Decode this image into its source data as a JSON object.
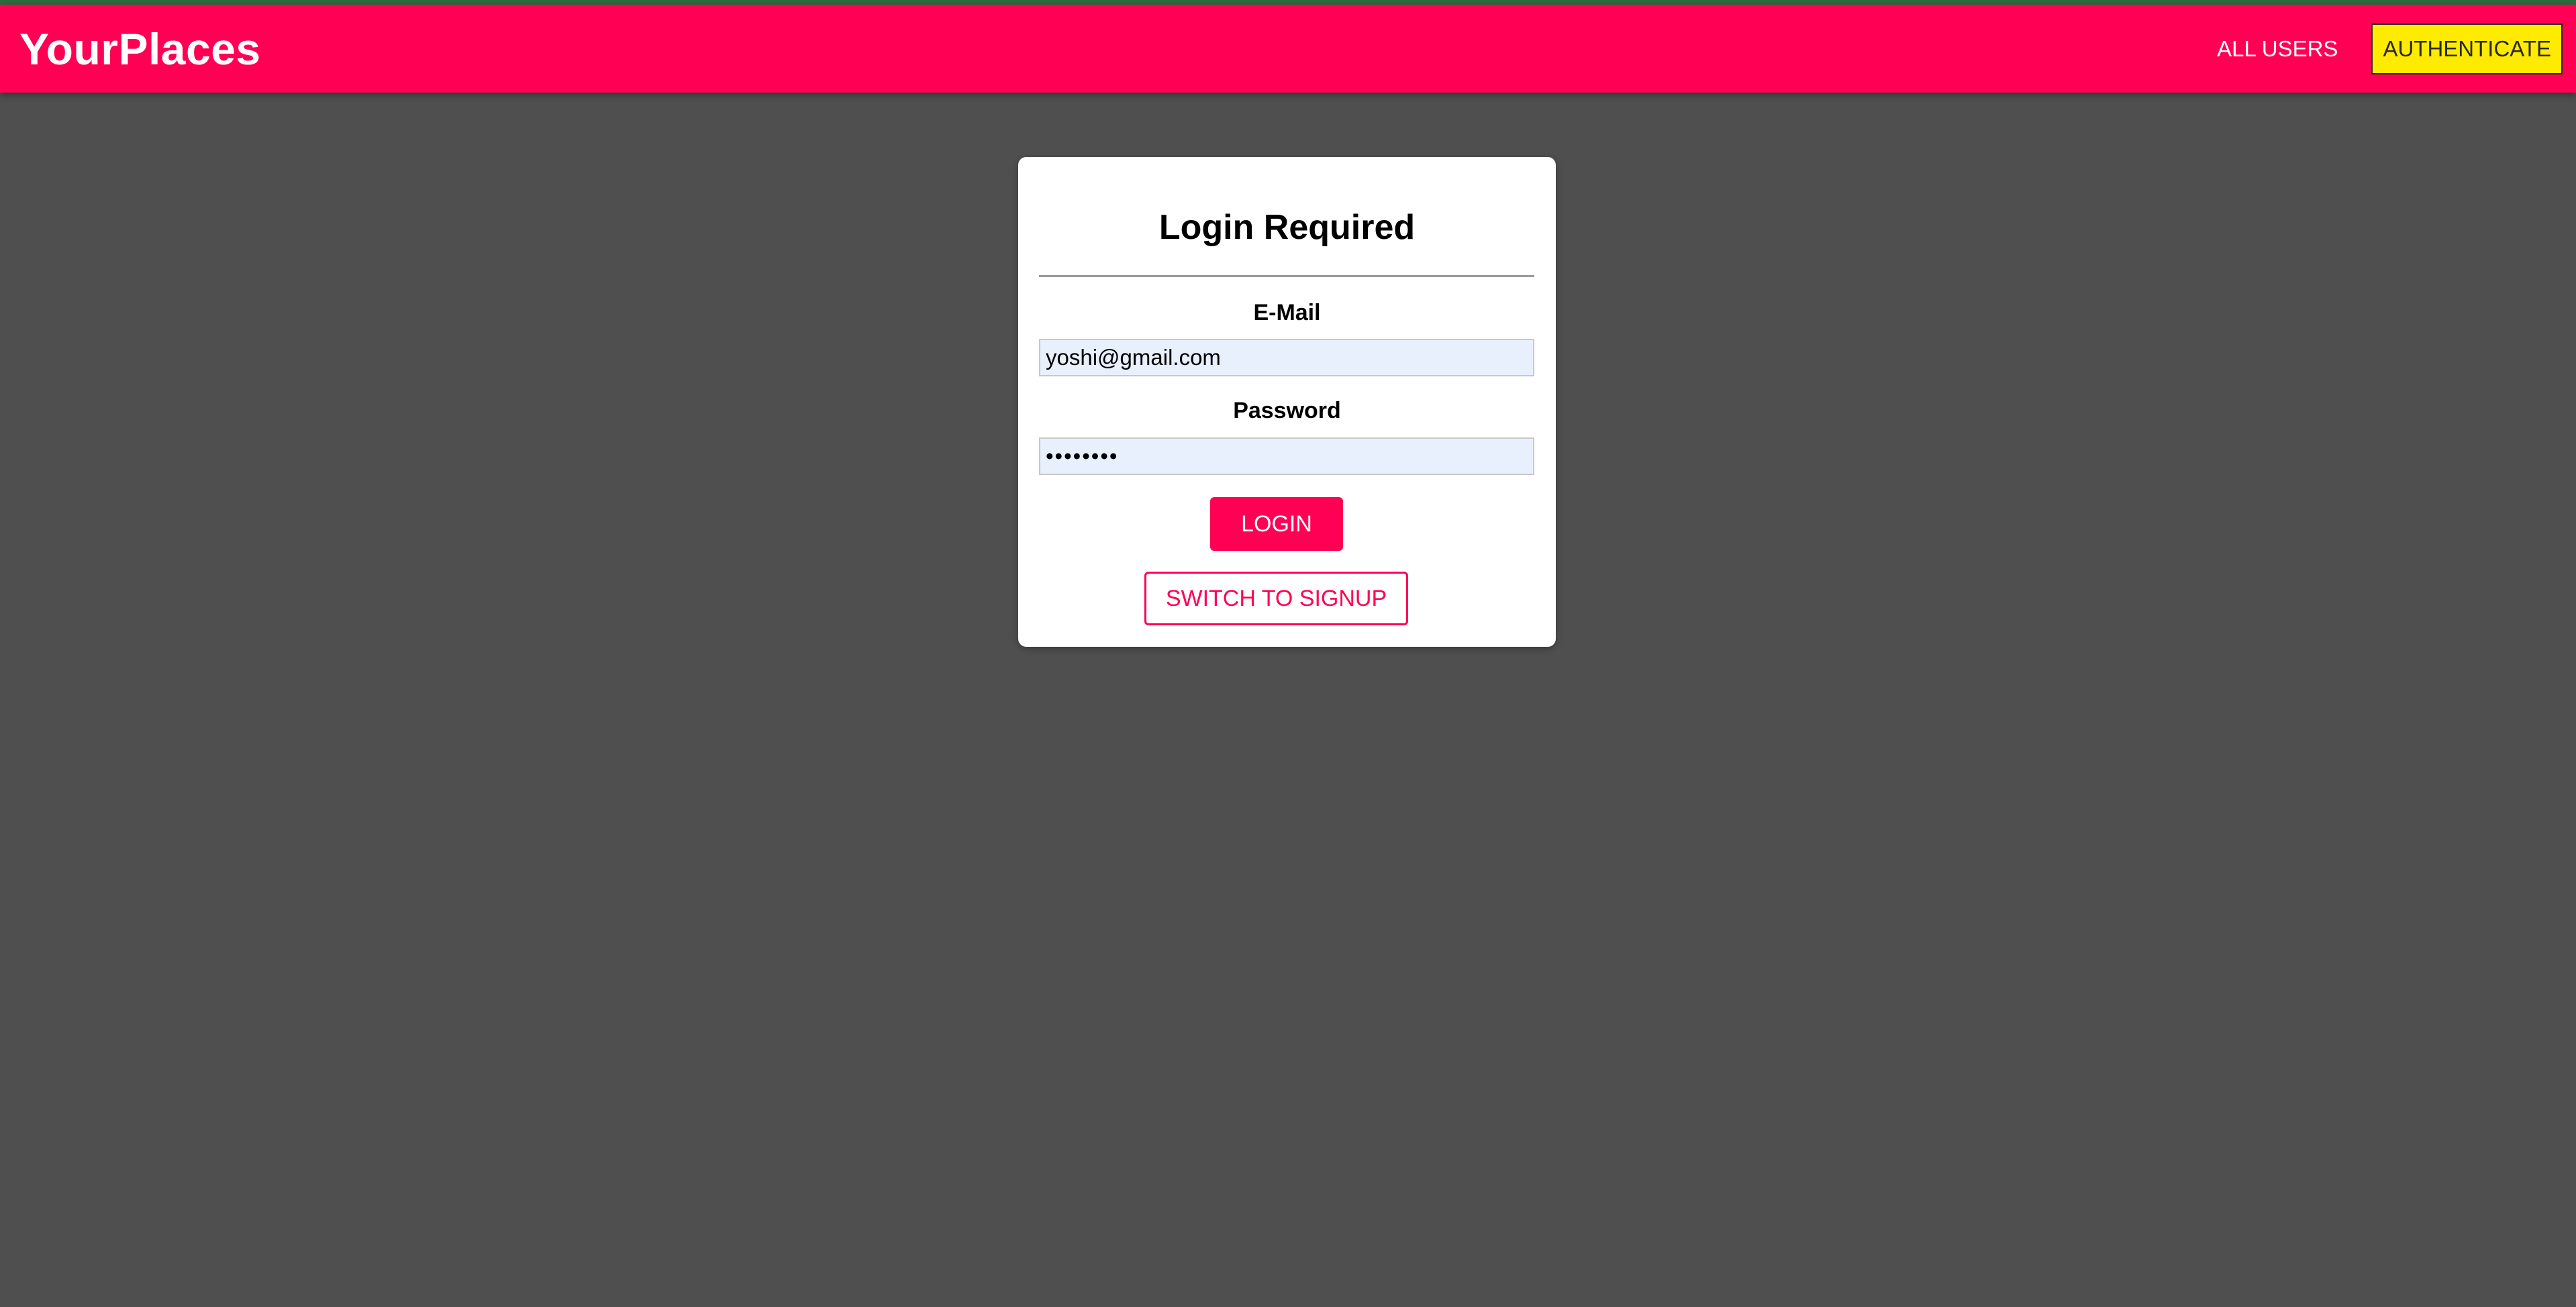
{
  "header": {
    "logo": "YourPlaces",
    "nav": {
      "all_users": "ALL USERS",
      "authenticate": "AUTHENTICATE"
    }
  },
  "auth_card": {
    "title": "Login Required",
    "email": {
      "label": "E-Mail",
      "value": "yoshi@gmail.com"
    },
    "password": {
      "label": "Password",
      "value": "password"
    },
    "login_button": "LOGIN",
    "switch_button": "SWITCH TO SIGNUP"
  },
  "colors": {
    "brand": "#ff0055",
    "accent": "#ffeb00",
    "background": "#4f4f4f",
    "input_fill": "#e8f0fe"
  }
}
